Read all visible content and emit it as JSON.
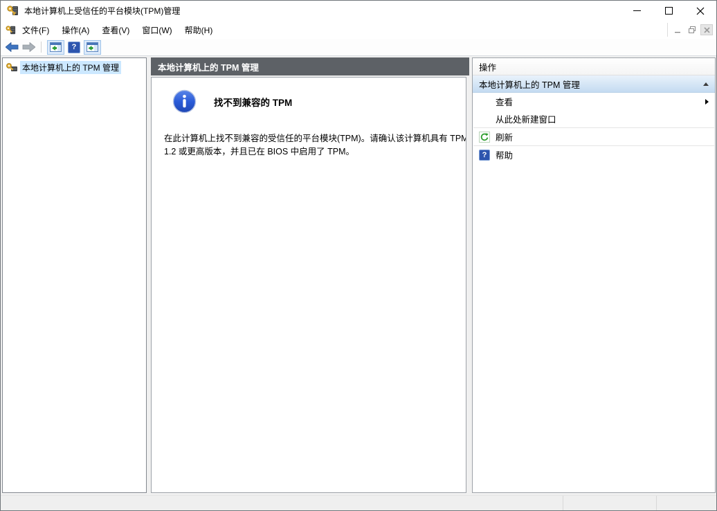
{
  "window": {
    "title": "本地计算机上受信任的平台模块(TPM)管理",
    "app_icon": "tpm-key-icon"
  },
  "menubar": {
    "items": [
      {
        "label": "文件(F)"
      },
      {
        "label": "操作(A)"
      },
      {
        "label": "查看(V)"
      },
      {
        "label": "窗口(W)"
      },
      {
        "label": "帮助(H)"
      }
    ]
  },
  "toolbar": {
    "buttons": [
      {
        "name": "back"
      },
      {
        "name": "forward"
      },
      {
        "name": "show-hide-console-tree",
        "toggled": true
      },
      {
        "name": "help"
      },
      {
        "name": "show-hide-action-pane",
        "toggled": true
      }
    ],
    "help_glyph": "?"
  },
  "tree": {
    "items": [
      {
        "label": "本地计算机上的 TPM 管理",
        "selected": true,
        "icon": "tpm-key-icon"
      }
    ]
  },
  "content": {
    "header": "本地计算机上的 TPM 管理",
    "message_title": "找不到兼容的 TPM",
    "message_body": "在此计算机上找不到兼容的受信任的平台模块(TPM)。请确认该计算机具有 TPM 1.2 或更高版本，并且已在 BIOS 中启用了 TPM。"
  },
  "actions": {
    "header": "操作",
    "group_title": "本地计算机上的 TPM 管理",
    "group_collapsed": false,
    "items": [
      {
        "label": "查看",
        "has_submenu": true
      },
      {
        "label": "从此处新建窗口"
      },
      {
        "label": "刷新",
        "icon": "refresh-icon"
      },
      {
        "label": "帮助",
        "icon": "help-icon",
        "icon_glyph": "?"
      }
    ]
  },
  "colors": {
    "selection": "#cce8ff",
    "center_header_bg": "#5d6166",
    "actions_group_top": "#e9f2fb",
    "actions_group_bottom": "#c4dbf1",
    "info_icon_blue": "#2b5cd8",
    "refresh_green": "#2f9e2f",
    "toolbar_toggle_bg": "#ddeafa",
    "status_bar_bg": "#efefef"
  }
}
